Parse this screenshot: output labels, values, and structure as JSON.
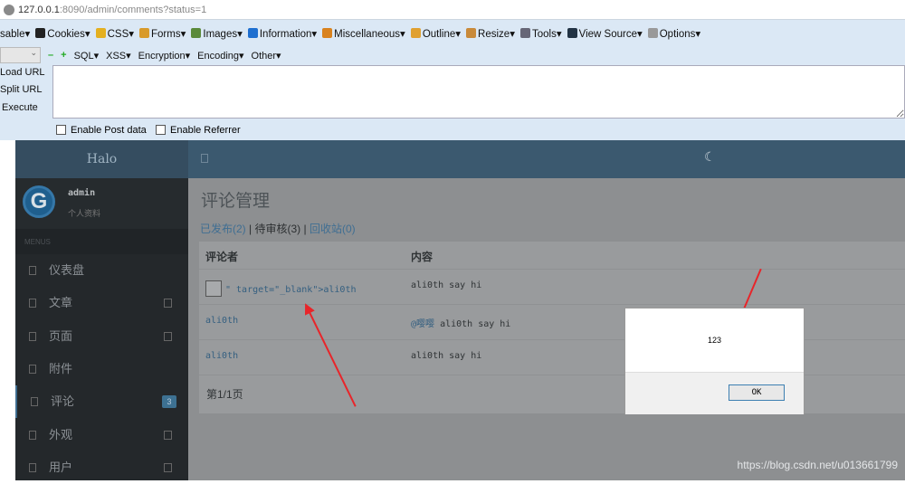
{
  "browser": {
    "url_host": "127.0.0.1",
    "url_rest": ":8090/admin/comments?status=1"
  },
  "hackbar": {
    "menu": [
      {
        "label": "sable▾",
        "icon": "none",
        "color": ""
      },
      {
        "label": "Cookies▾",
        "icon": "user-icon",
        "color": "#222"
      },
      {
        "label": "CSS▾",
        "icon": "wand-icon",
        "color": "#e4b020"
      },
      {
        "label": "Forms▾",
        "icon": "clipboard-icon",
        "color": "#d89a2a"
      },
      {
        "label": "Images▾",
        "icon": "image-icon",
        "color": "#5a8a3a"
      },
      {
        "label": "Information▾",
        "icon": "info-icon",
        "color": "#1e6fd0"
      },
      {
        "label": "Miscellaneous▾",
        "icon": "box-icon",
        "color": "#d9821e"
      },
      {
        "label": "Outline▾",
        "icon": "pencil-icon",
        "color": "#e0a030"
      },
      {
        "label": "Resize▾",
        "icon": "ruler-icon",
        "color": "#c98a3a"
      },
      {
        "label": "Tools▾",
        "icon": "tools-icon",
        "color": "#667"
      },
      {
        "label": "View Source▾",
        "icon": "terminal-icon",
        "color": "#234"
      },
      {
        "label": "Options▾",
        "icon": "options-icon",
        "color": "#999"
      }
    ],
    "menu2": [
      "SQL▾",
      "XSS▾",
      "Encryption▾",
      "Encoding▾",
      "Other▾"
    ],
    "load_url": "Load URL",
    "split_url": "Split URL",
    "execute": "Execute",
    "post": "Enable Post data",
    "referrer": "Enable Referrer"
  },
  "sidebar": {
    "brand": "Halo",
    "avatar": "G",
    "user": "admin",
    "profile": "个人资料",
    "menus_label": "MENUS",
    "items": [
      {
        "label": "仪表盘"
      },
      {
        "label": "文章"
      },
      {
        "label": "页面"
      },
      {
        "label": "附件"
      },
      {
        "label": "评论",
        "badge": "3"
      },
      {
        "label": "外观"
      },
      {
        "label": "用户"
      }
    ]
  },
  "main": {
    "title": "评论管理",
    "tabs": [
      "已发布(2)",
      "待审核(3)",
      "回收站(0)"
    ],
    "sep": "|",
    "headers": [
      "评论者",
      "内容"
    ],
    "rows": [
      {
        "author": "\" target=\"_blank\">ali0th",
        "content": "ali0th say hi",
        "mention": ""
      },
      {
        "author": "ali0th",
        "content": "ali0th say hi",
        "mention": "@嘤嘤"
      },
      {
        "author": "ali0th",
        "content": "ali0th say hi",
        "mention": ""
      }
    ],
    "pager": "第1/1页"
  },
  "dialog": {
    "message": "123",
    "ok": "OK"
  },
  "watermark": "https://blog.csdn.net/u013661799"
}
